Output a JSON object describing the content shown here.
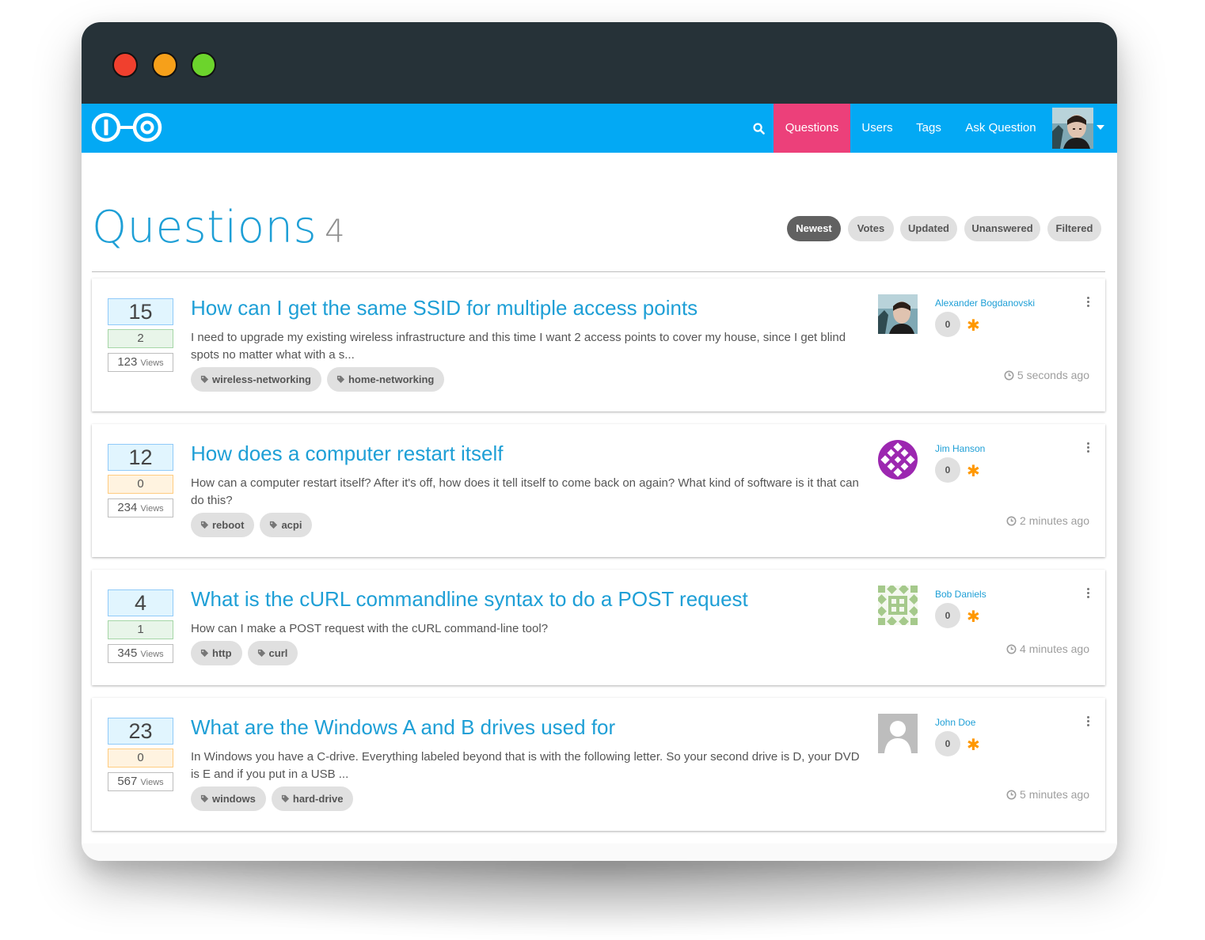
{
  "window": {
    "controls": [
      "close",
      "minimize",
      "maximize"
    ]
  },
  "nav": {
    "logo_icon": "io-logo",
    "search_icon": "search-icon",
    "items": [
      {
        "label": "Questions",
        "active": true
      },
      {
        "label": "Users",
        "active": false
      },
      {
        "label": "Tags",
        "active": false
      },
      {
        "label": "Ask Question",
        "active": false
      }
    ],
    "avatar_icon": "user-avatar",
    "caret_icon": "caret-down-icon"
  },
  "page": {
    "title": "Questions",
    "count": "4",
    "sort_buttons": [
      {
        "label": "Newest",
        "active": true
      },
      {
        "label": "Votes",
        "active": false
      },
      {
        "label": "Updated",
        "active": false
      },
      {
        "label": "Unanswered",
        "active": false
      },
      {
        "label": "Filtered",
        "active": false
      }
    ]
  },
  "questions": [
    {
      "votes": "15",
      "answers": "2",
      "answered": true,
      "views": "123",
      "views_label": "Views",
      "title": "How can I get the same SSID for multiple access points",
      "excerpt": "I need to upgrade my existing wireless infrastructure and this time I want 2 access points to cover my house, since I get blind spots no matter what with a s...",
      "tags": [
        "wireless-networking",
        "home-networking"
      ],
      "author": "Alexander Bogdanovski",
      "reputation": "0",
      "avatar": "photo-avatar",
      "time": "5 seconds ago"
    },
    {
      "votes": "12",
      "answers": "0",
      "answered": false,
      "views": "234",
      "views_label": "Views",
      "title": "How does a computer restart itself",
      "excerpt": "How can a computer restart itself? After it's off, how does it tell itself to come back on again? What kind of software is it that can do this?",
      "tags": [
        "reboot",
        "acpi"
      ],
      "author": "Jim Hanson",
      "reputation": "0",
      "avatar": "purple-identicon",
      "time": "2 minutes ago"
    },
    {
      "votes": "4",
      "answers": "1",
      "answered": true,
      "views": "345",
      "views_label": "Views",
      "title": "What is the cURL commandline syntax to do a POST request",
      "excerpt": "How can I make a POST request with the cURL command-line tool?",
      "tags": [
        "http",
        "curl"
      ],
      "author": "Bob Daniels",
      "reputation": "0",
      "avatar": "green-identicon",
      "time": "4 minutes ago"
    },
    {
      "votes": "23",
      "answers": "0",
      "answered": false,
      "views": "567",
      "views_label": "Views",
      "title": "What are the Windows A and B drives used for",
      "excerpt": "In Windows you have a C-drive. Everything labeled beyond that is with the following letter. So your second drive is D, your DVD is E and if you put in a USB ...",
      "tags": [
        "windows",
        "hard-drive"
      ],
      "author": "John Doe",
      "reputation": "0",
      "avatar": "default-avatar",
      "time": "5 minutes ago"
    }
  ],
  "colors": {
    "titlebar": "#263238",
    "navbar": "#03a9f4",
    "nav_active": "#ec407a",
    "link": "#1e9fd6",
    "star": "#ff9800"
  }
}
